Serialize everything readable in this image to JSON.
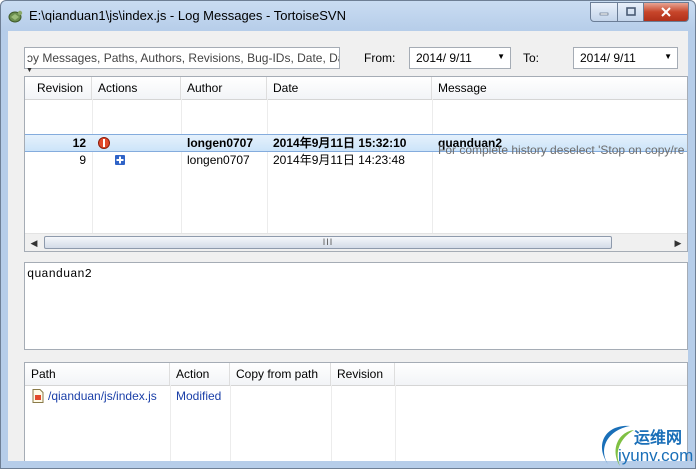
{
  "window": {
    "title": "E:\\qianduan1\\js\\index.js - Log Messages - TortoiseSVN",
    "app_icon": "tortoise-icon",
    "controls": {
      "minimize": "minimize-icon",
      "maximize": "maximize-icon",
      "close": "close-icon"
    }
  },
  "toolbar": {
    "filter_placeholder": "ɔy Messages, Paths, Authors, Revisions, Bug-IDs, Date, Date",
    "from_label": "From:",
    "from_value": "2014/ 9/11",
    "to_label": "To:",
    "to_value": "2014/ 9/11"
  },
  "log_table": {
    "columns": [
      "Revision",
      "Actions",
      "Author",
      "Date",
      "Message"
    ],
    "rows": [
      {
        "revision": "12",
        "action_icon": "modified-icon",
        "author": "longen0707",
        "date": "2014年9月11日 15:32:10",
        "message": "quanduan2",
        "selected": true
      },
      {
        "revision": "9",
        "action_icon": "added-icon",
        "author": "longen0707",
        "date": "2014年9月11日 14:23:48",
        "message": "",
        "selected": false
      }
    ],
    "hint": "For complete history deselect 'Stop on copy/re",
    "scroll_grip": "III"
  },
  "message_text": "quanduan2",
  "paths_table": {
    "columns": [
      "Path",
      "Action",
      "Copy from path",
      "Revision"
    ],
    "rows": [
      {
        "path": "/qianduan/js/index.js",
        "action": "Modified",
        "copy_from": "",
        "revision": "",
        "icon": "file-icon"
      }
    ]
  },
  "watermark": {
    "cn": "运维网",
    "url": "iyunv.com"
  },
  "colors": {
    "selection": "#cce4f9",
    "link": "#1a3fa8",
    "titlebar": "#b6cde9"
  }
}
